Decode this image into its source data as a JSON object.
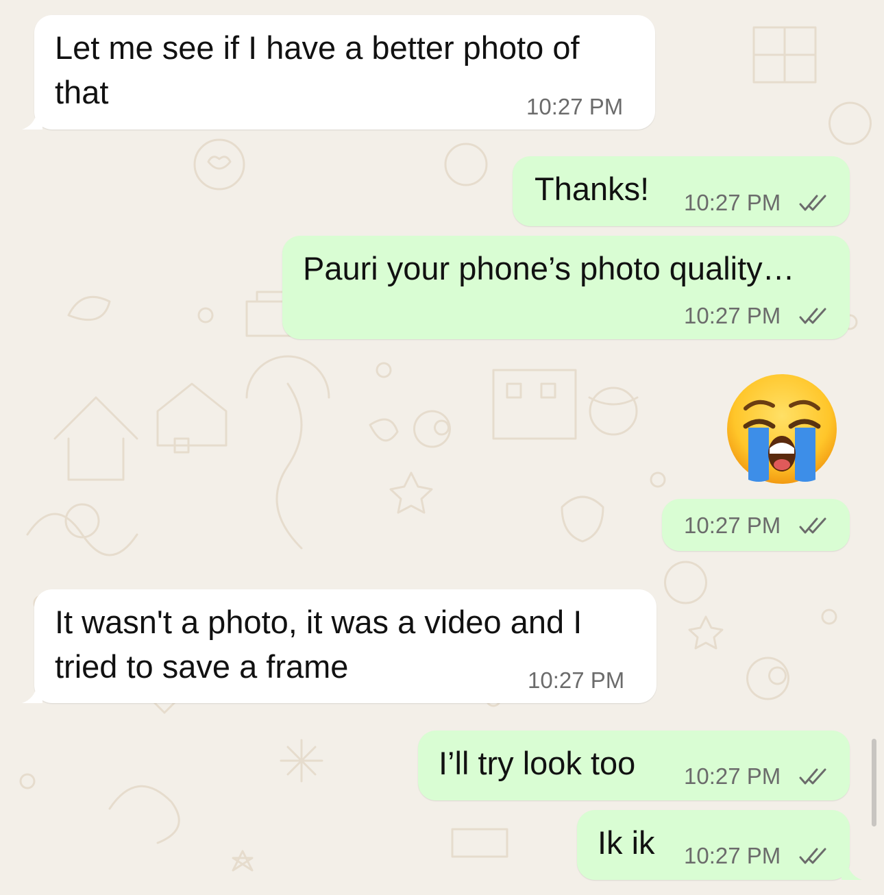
{
  "chat": {
    "messages": [
      {
        "direction": "incoming",
        "lines": [
          "Let me see if I have a better photo of",
          "that"
        ],
        "time": "10:27 PM"
      },
      {
        "direction": "outgoing",
        "text": "Thanks!",
        "time": "10:27 PM",
        "status": "read",
        "status_icon": "double-check-icon"
      },
      {
        "direction": "outgoing",
        "text": "Pauri your phone’s photo quality…",
        "time": "10:27 PM",
        "status": "read",
        "status_icon": "double-check-icon"
      },
      {
        "direction": "outgoing",
        "emoji": "loudly-crying-face",
        "time": "10:27 PM",
        "status": "read",
        "status_icon": "double-check-icon"
      },
      {
        "direction": "incoming",
        "lines": [
          "It wasn't a photo, it was a video and I",
          "tried to save a frame"
        ],
        "time": "10:27 PM"
      },
      {
        "direction": "outgoing",
        "text": "I’ll try look too",
        "time": "10:27 PM",
        "status": "read",
        "status_icon": "double-check-icon"
      },
      {
        "direction": "outgoing",
        "text": "Ik ik",
        "time": "10:27 PM",
        "status": "read",
        "status_icon": "double-check-icon"
      }
    ]
  },
  "colors": {
    "background": "#f3efe8",
    "incoming_bubble": "#ffffff",
    "outgoing_bubble": "#d9fdd3",
    "timestamp": "#6b6b6b",
    "read_ticks": "#6b6b6b"
  }
}
